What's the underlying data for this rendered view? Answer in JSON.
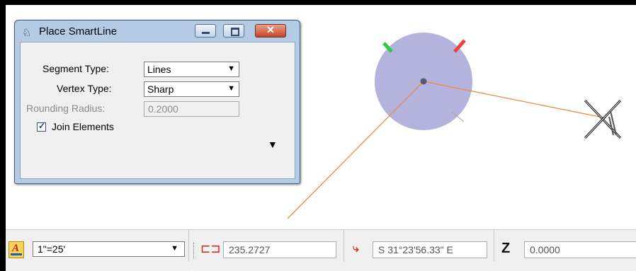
{
  "dialog": {
    "title": "Place SmartLine",
    "close_glyph": "✕",
    "segment_type_label": "Segment Type:",
    "segment_type_value": "Lines",
    "vertex_type_label": "Vertex Type:",
    "vertex_type_value": "Sharp",
    "rounding_radius_label": "Rounding Radius:",
    "rounding_radius_value": "0.2000",
    "join_elements_label": "Join Elements",
    "join_elements_checked": true,
    "check_glyph": "✓",
    "expand_glyph": "▼",
    "dropdown_glyph": "▼",
    "icons": {
      "title": "smartline-tool-icon"
    }
  },
  "statusbar": {
    "acs_glyph": "A",
    "scale_value": "1\"=25'",
    "dropdown_glyph": "▼",
    "distance_value": "235.2727",
    "direction_value": "S 31°23'56.33\" E",
    "z_label": "Z",
    "z_value": "0.0000",
    "dist_glyph": "⊏⊐",
    "dir_glyph": "⤷",
    "caret_glyph": "▲"
  },
  "colors": {
    "background": "#ffffff",
    "frame": "#000000",
    "circle": "#b3b3dd",
    "line": "#f08a3c",
    "tick_green": "#2ecc40",
    "tick_red": "#e8433a",
    "dialog_frame": "#b4cbe6"
  }
}
